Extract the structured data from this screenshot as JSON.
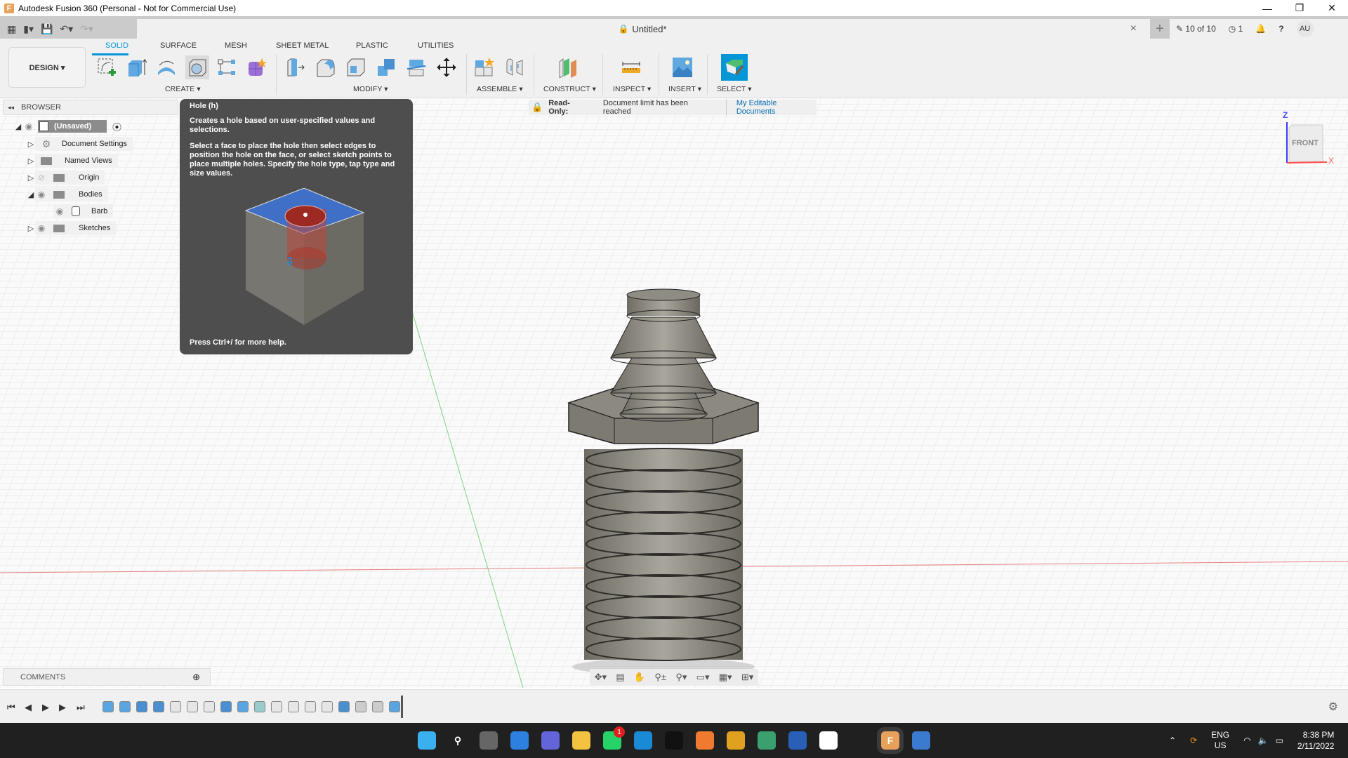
{
  "window": {
    "title": "Autodesk Fusion 360 (Personal - Not for Commercial Use)",
    "app_icon": "F",
    "minimize": "—",
    "maximize": "❐",
    "close": "✕"
  },
  "quick_access": {
    "doc_title": "Untitled*",
    "doc_close": "×",
    "new_tab": "+",
    "doc_count": "10 of 10",
    "jobs_count": "1",
    "avatar": "AU"
  },
  "toolbar": {
    "workspace": "DESIGN ▾",
    "tabs": [
      "SOLID",
      "SURFACE",
      "MESH",
      "SHEET METAL",
      "PLASTIC",
      "UTILITIES"
    ],
    "active_tab": "SOLID",
    "groups": [
      "CREATE ▾",
      "MODIFY ▾",
      "ASSEMBLE ▾",
      "CONSTRUCT ▾",
      "INSPECT ▾",
      "INSERT ▾",
      "SELECT ▾"
    ]
  },
  "browser": {
    "title": "BROWSER",
    "items": [
      {
        "label": "(Unsaved)",
        "expanded": true,
        "icon": "component-icon"
      },
      {
        "label": "Document Settings",
        "expanded": false,
        "icon": "gear-icon"
      },
      {
        "label": "Named Views",
        "expanded": false,
        "icon": "folder-icon"
      },
      {
        "label": "Origin",
        "expanded": false,
        "icon": "folder-icon",
        "hidden": true
      },
      {
        "label": "Bodies",
        "expanded": true,
        "icon": "folder-icon"
      },
      {
        "label": "Barb",
        "icon": "body-icon"
      },
      {
        "label": "Sketches",
        "expanded": false,
        "icon": "folder-icon"
      }
    ]
  },
  "tooltip": {
    "title": "Hole (h)",
    "summary": "Creates a hole based on user-specified values and selections.",
    "detail": "Select a face to place the hole then select edges to position the hole on the face, or select sketch points to place multiple holes. Specify the hole type, tap type and size values.",
    "footer": "Press Ctrl+/ for more help."
  },
  "banner": {
    "label": "Read-Only:",
    "message": "Document limit has been reached",
    "link": "My Editable Documents"
  },
  "viewcube": {
    "face": "FRONT",
    "axis_z": "Z",
    "axis_x": "X"
  },
  "comments": {
    "label": "COMMENTS"
  },
  "taskbar": {
    "apps": [
      "start",
      "search",
      "task-view",
      "widgets",
      "teams-chat",
      "file-explorer",
      "whatsapp",
      "edge",
      "terminal",
      "xampp",
      "chrome",
      "atom",
      "virtualbox",
      "slack",
      "inkscape",
      "fusion-360",
      "settings"
    ],
    "whatsapp_badge": "1",
    "lang": "ENG",
    "region": "US",
    "time": "8:38 PM",
    "date": "2/11/2022"
  },
  "colors": {
    "accent": "#0696d7",
    "readonly": "#d9262c",
    "link": "#0a6fb7"
  }
}
